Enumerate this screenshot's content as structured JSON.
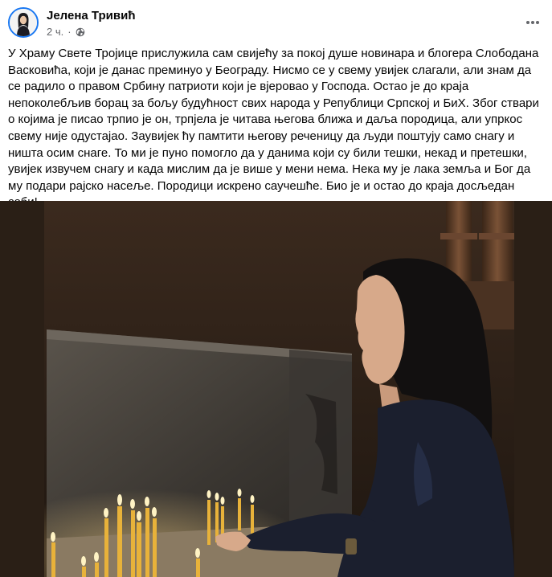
{
  "post": {
    "author_name": "Јелена Тривић",
    "time": "2 ч.",
    "separator": "·",
    "privacy_icon": "globe-icon",
    "more_icon": "more-horizontal-icon",
    "text": "У Храму Свете Тројице прислужила сам свијећу за покој душе новинара и блогера Слободана Васковића, који је данас преминуо у Београду. Нисмо се у свему увијек слагали, али знам да се радило о правом Србину патриоти који је вјеровао у Господа. Остао је до краја непоколебљив борац за бољу будућност свих народа у Републици Српској и БиХ. Због ствари о којима је писао трпио је он, трпјела је читава његова ближа и даља породица, али упркос свему није одустајао. Заувијек ћу памтити његову реченицу да људи поштују само снагу и ништа осим снаге. То ми је пуно помогло да у данима који су били тешки, некад и претешки, увијек извучем снагу и када мислим да је више у мени нема. Нека му је лака земља и Бог да му подари рајско насеље. Породици искрено саучешће. Био је и остао до краја досљедан себи!"
  },
  "colors": {
    "brand_blue": "#1877f2",
    "secondary_text": "#65676b",
    "primary_text": "#050505"
  }
}
